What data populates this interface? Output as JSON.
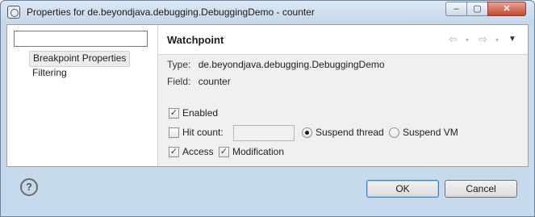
{
  "window": {
    "title": "Properties for de.beyondjava.debugging.DebuggingDemo - counter",
    "minimize_glyph": "–",
    "maximize_glyph": "▢",
    "close_glyph": "✕"
  },
  "nav": {
    "filter_value": "",
    "items": [
      {
        "label": "Breakpoint Properties",
        "selected": true
      },
      {
        "label": "Filtering",
        "selected": false
      }
    ]
  },
  "header": {
    "title": "Watchpoint",
    "back_icon": "⇦",
    "forward_icon": "⇨",
    "dropdown_icon": "▾",
    "menu_icon": "▼"
  },
  "info": {
    "type_label": "Type:",
    "type_value": "de.beyondjava.debugging.DebuggingDemo",
    "field_label": "Field:",
    "field_value": "counter"
  },
  "options": {
    "enabled": {
      "label": "Enabled",
      "checked": true
    },
    "hit_count": {
      "label": "Hit count:",
      "checked": false,
      "value": ""
    },
    "suspend_thread": {
      "label": "Suspend thread",
      "selected": true
    },
    "suspend_vm": {
      "label": "Suspend VM",
      "selected": false
    },
    "access": {
      "label": "Access",
      "checked": true
    },
    "modification": {
      "label": "Modification",
      "checked": true
    }
  },
  "footer": {
    "help_glyph": "?",
    "ok_label": "OK",
    "cancel_label": "Cancel"
  },
  "icons": {
    "check_glyph": "✓"
  }
}
